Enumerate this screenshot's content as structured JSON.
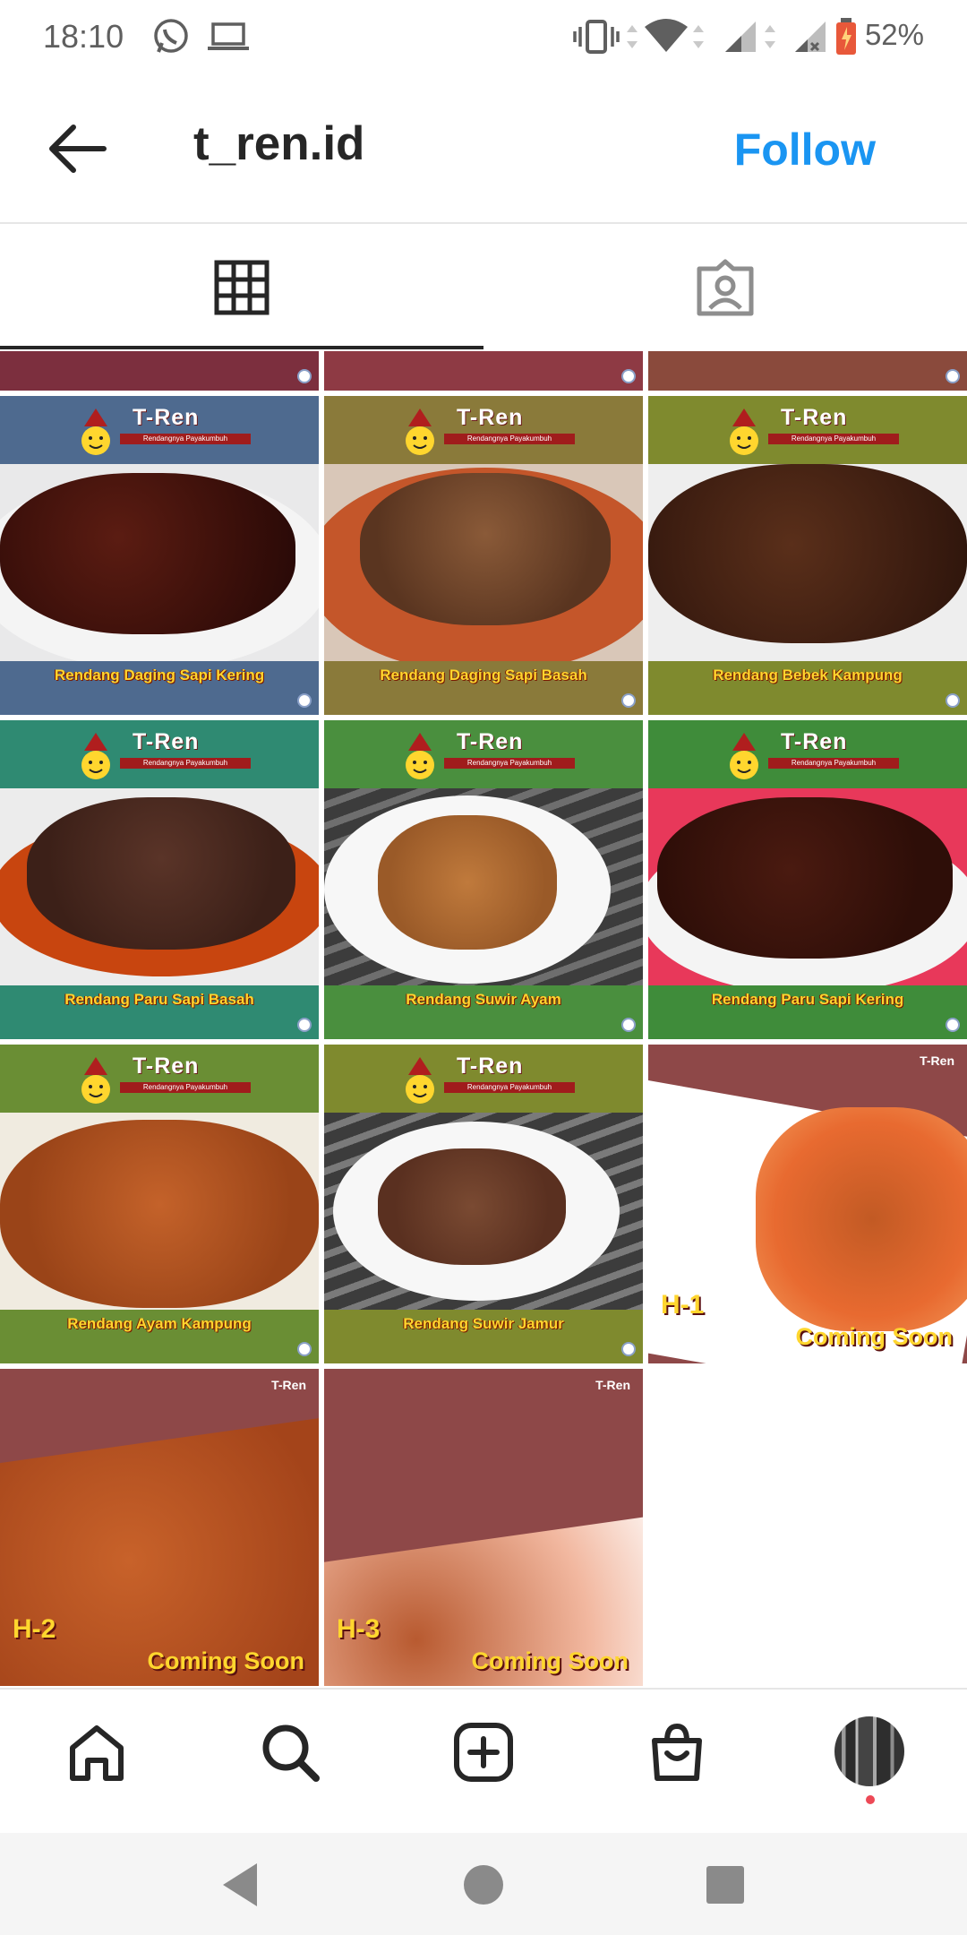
{
  "status_bar": {
    "time": "18:10",
    "battery": "52%"
  },
  "header": {
    "username": "t_ren.id",
    "follow_label": "Follow"
  },
  "tabs": [
    {
      "name": "grid",
      "icon": "grid-icon",
      "selected": true
    },
    {
      "name": "tagged",
      "icon": "tagged-person-icon",
      "selected": false
    }
  ],
  "brand": {
    "logo_text": "T-Ren",
    "logo_sub": "Rendangnya Payakumbuh"
  },
  "posts": [
    {
      "caption": "Rendang Daging Sapi Kering"
    },
    {
      "caption": "Rendang Daging Sapi Basah"
    },
    {
      "caption": "Rendang Bebek Kampung"
    },
    {
      "caption": "Rendang Paru Sapi Basah"
    },
    {
      "caption": "Rendang Suwir Ayam"
    },
    {
      "caption": "Rendang Paru Sapi Kering"
    },
    {
      "caption": "Rendang Ayam Kampung"
    },
    {
      "caption": "Rendang Suwir Jamur"
    }
  ],
  "coming_posts": [
    {
      "day": "H-1",
      "label": "Coming Soon"
    },
    {
      "day": "H-2",
      "label": "Coming Soon"
    },
    {
      "day": "H-3",
      "label": "Coming Soon"
    }
  ],
  "colors": {
    "accent_blue": "#1a95f2",
    "maroon": "#8e4848",
    "olive": "#7f8a2e",
    "teal": "#2f8a72",
    "green": "#4a8f3e",
    "slate": "#4e6a8f",
    "caption_yellow": "#ffd62e"
  },
  "bottom_nav": [
    "home-icon",
    "search-icon",
    "new-post-icon",
    "shop-icon",
    "profile-avatar"
  ]
}
